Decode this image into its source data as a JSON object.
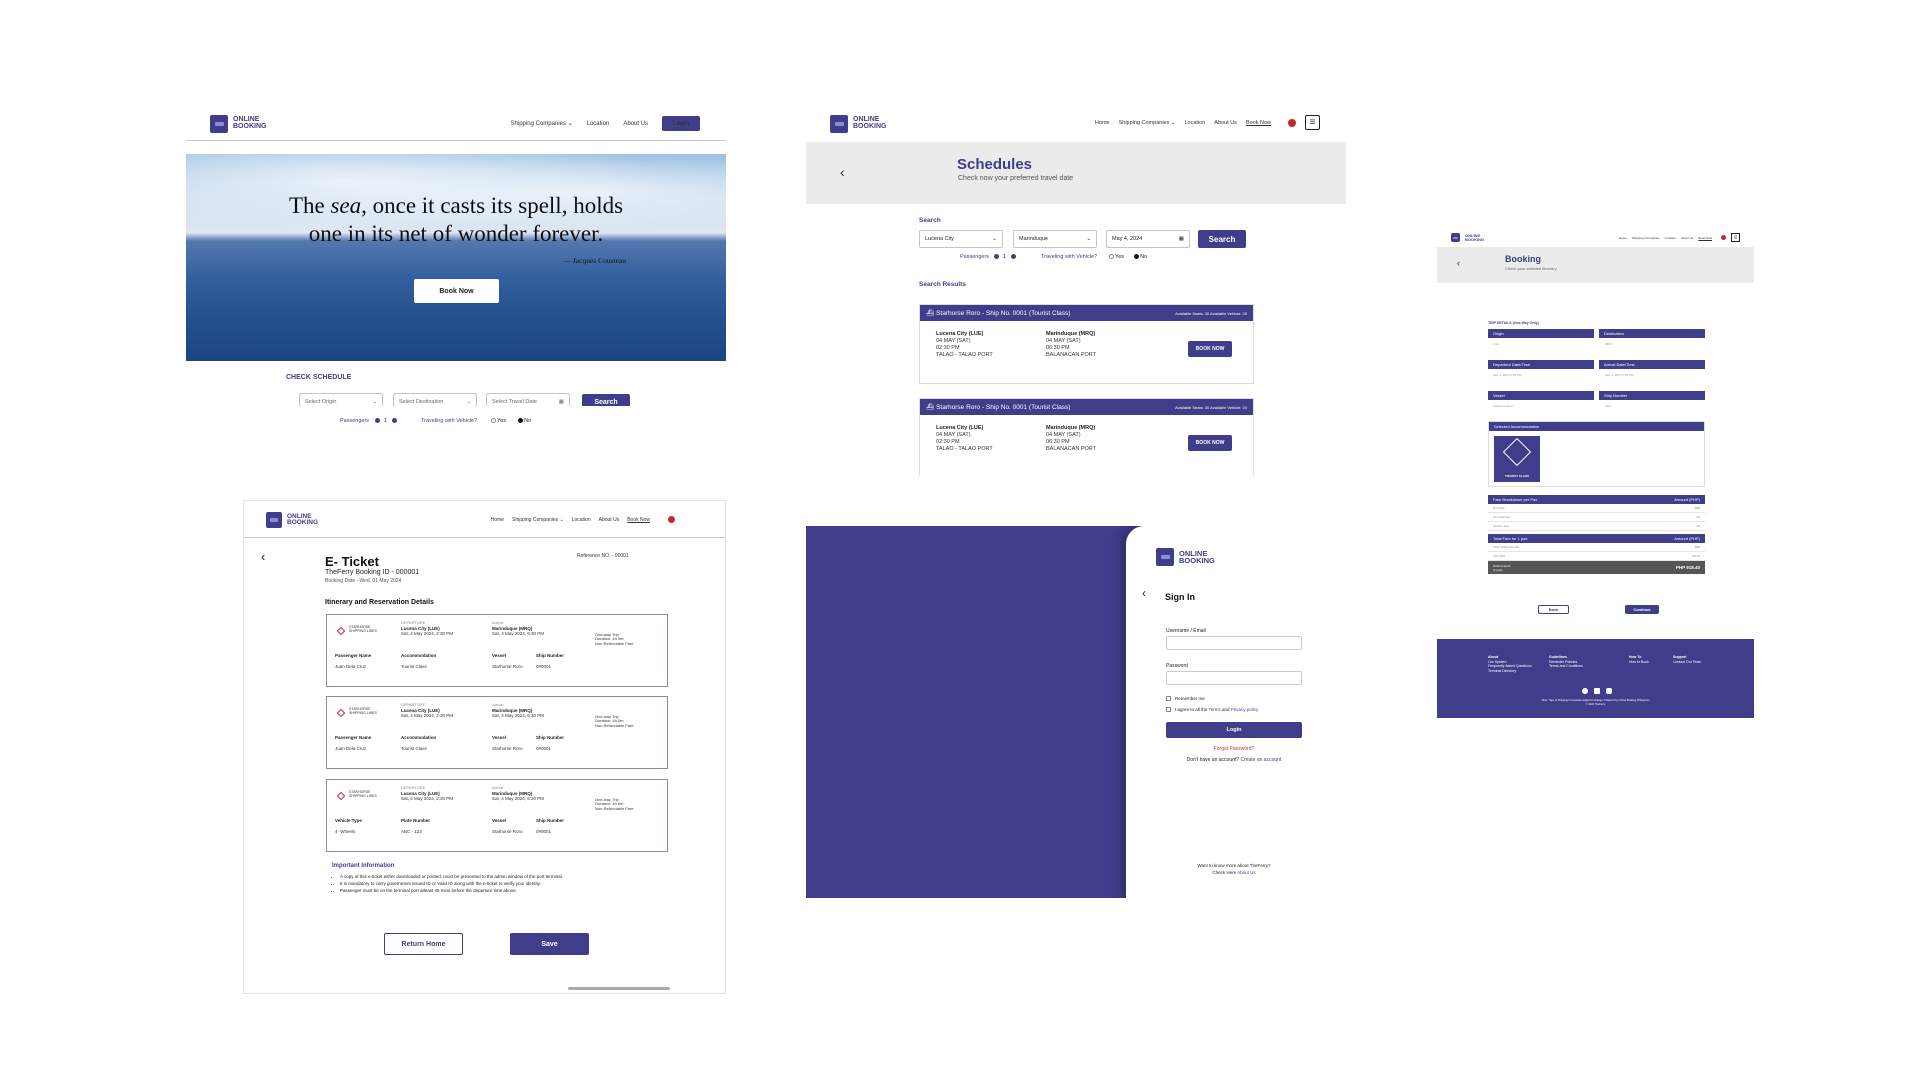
{
  "brand": {
    "line1": "ONLINE",
    "line2": "BOOKING"
  },
  "landing": {
    "nav": {
      "shipping": "Shipping Companies",
      "location": "Location",
      "about": "About Us",
      "login": "Login"
    },
    "quote_line1_a": "The ",
    "quote_sea": "sea",
    "quote_line1_b": ", once it casts its spell, holds",
    "quote_line2": "one in its net of wonder forever.",
    "author": "— Jacques Cousteau",
    "book_now": "Book Now",
    "check_schedule": "CHECK SCHEDULE",
    "origin_placeholder": "Select Origin",
    "destination_placeholder": "Select Destination",
    "date_placeholder": "Select Travel Date",
    "search": "Search",
    "passengers": "Passengers",
    "passenger_count": "1",
    "vehicle_q": "Traveling with Vehicle?",
    "yes": "Yes",
    "no": "No"
  },
  "schedules": {
    "nav": {
      "home": "Home",
      "shipping": "Shipping Companies",
      "location": "Location",
      "about": "About Us",
      "book": "Book Now"
    },
    "title": "Schedules",
    "subtitle": "Check now your preferred travel date",
    "search_label": "Search",
    "origin_value": "Lucena City",
    "destination_value": "Marinduque",
    "date_value": "May 4, 2024",
    "search_btn": "Search",
    "passengers": "Passengers",
    "passenger_count": "1",
    "vehicle_q": "Traveling with Vehicle?",
    "yes": "Yes",
    "no": "No",
    "results_label": "Search Results",
    "results": [
      {
        "header": "Starhorse Roro  -  Ship No. 0001 (Tourist Class)",
        "availability": "Available Seats: 30   Available Vehicle: 20",
        "from_name": "Lucena City (LUE)",
        "from_date": "04 MAY (SAT)",
        "from_time": "02:30 PM",
        "from_port": "TALAO - TALAO PORT",
        "to_name": "Marinduque (MRQ)",
        "to_date": "04 MAY (SAT)",
        "to_time": "06:30 PM",
        "to_port": "BALANACAN PORT",
        "book": "BOOK NOW"
      },
      {
        "header": "Starhorse Roro  -  Ship No. 0001 (Tourist Class)",
        "availability": "Available Seats: 30   Available Vehicle: 20",
        "from_name": "Lucena City (LUE)",
        "from_date": "04 MAY (SAT)",
        "from_time": "02:30 PM",
        "from_port": "TALAO - TALAO PORT",
        "to_name": "Marinduque (MRQ)",
        "to_date": "04 MAY (SAT)",
        "to_time": "06:30 PM",
        "to_port": "BALANACAN PORT",
        "book": "BOOK NOW"
      }
    ]
  },
  "booking": {
    "nav": {
      "home": "Home",
      "shipping": "Shipping Companies",
      "location": "Location",
      "about": "About Us",
      "book": "Book Now"
    },
    "title": "Booking",
    "subtitle": "Check your selected itinerary",
    "trip_details": "TRIP DETAILS (One-Way Only)",
    "origin": "Origin",
    "destination": "Destination",
    "departure": "Departure Date/Time",
    "arrival": "Arrival Date/Time",
    "vessel": "Vessel",
    "ship_number": "Ship Number",
    "origin_val": "LUE",
    "dest_val": "MRQ",
    "dep_val": "May 4, 2024 2:30 PM",
    "arr_val": "May 4, 2024 6:30 PM",
    "vessel_val": "Starhorse Roro",
    "ship_val": "0001",
    "selected_accommodation": "Selected Accommodation",
    "accommodation_card": "TOURIST CLASS",
    "fare_breakdown": "Fare Breakdown per Pax",
    "amount_php": "Amount (PHP)",
    "fare_rows": [
      {
        "label": "Net Fare",
        "value": "800"
      },
      {
        "label": "Terminal Fee",
        "value": "30"
      },
      {
        "label": "Service Fee",
        "value": "50"
      }
    ],
    "total_fare_for": "Total Fare for 1 pax",
    "total_rows": [
      {
        "label": "Total Ticket Amount",
        "value": "880"
      },
      {
        "label": "VAT 12%",
        "value": "98.40"
      }
    ],
    "total_amount_label": "Total Amount",
    "total_amount_sub": "(1 pax)",
    "total_amount_val": "PHP 918.40",
    "back": "Back",
    "continue": "Continue",
    "footer": {
      "cols": [
        {
          "title": "About",
          "items": [
            "Our System",
            "Frequently Asked Questions",
            "Terminal Directory"
          ]
        },
        {
          "title": "Guidelines",
          "items": [
            "Reminder Policies",
            "Terms and Conditions"
          ]
        },
        {
          "title": "How To",
          "items": [
            "How to Book"
          ]
        },
        {
          "title": "Support",
          "items": [
            "Contact Our Team"
          ]
        }
      ],
      "copyright": "Note: Trips of Shipping Companies subject to change. Powered by Online Booking Philippines",
      "copyright2": "© 2024 TheFerry"
    }
  },
  "eticket": {
    "nav": {
      "home": "Home",
      "shipping": "Shipping Companies",
      "location": "Location",
      "about": "About Us",
      "book": "Book Now"
    },
    "title": "E- Ticket",
    "booking_id": "TheFerry Booking ID - 000001",
    "booking_date": "Booking Date - Wed, 01 May 2024",
    "reference": "Reference NO. - 00001",
    "section_title": "Itinerary and Reservation Details",
    "tickets": [
      {
        "company": "STARHORSE SHIPPING LINES",
        "dep_label": "DEPARTURE",
        "dep_city": "Lucena City (LUE)",
        "dep_time": "Sat, 4 May 2024, 2:30 PM",
        "arr_label": "Arrival",
        "arr_city": "Marinduque (MRQ)",
        "arr_time": "Sat, 4 May 2024, 6:30 PM",
        "trip": "One-way Trip",
        "duration": "Duration: 4h 0m",
        "refund": "Non-Refundable Fare",
        "c1_label": "Passenger Name",
        "c1_val": "Juan Dela Cruz",
        "c2_label": "Accommodation",
        "c2_val": "Tourist Class",
        "c3_label": "Vessel",
        "c3_val": "Starhorse Roro",
        "c4_label": "Ship Number",
        "c4_val": "0#0001"
      },
      {
        "company": "STARHORSE SHIPPING LINES",
        "dep_label": "DEPARTURE",
        "dep_city": "Lucena City (LUE)",
        "dep_time": "Sat, 4 May 2024, 2:30 PM",
        "arr_label": "Arrival",
        "arr_city": "Marinduque (MRQ)",
        "arr_time": "Sat, 4 May 2024, 6:30 PM",
        "trip": "One-way Trip",
        "duration": "Duration: 4h 0m",
        "refund": "Non-Refundable Fare",
        "c1_label": "Passenger Name",
        "c1_val": "Juan Dela Cruz",
        "c2_label": "Accommodation",
        "c2_val": "Tourist Class",
        "c3_label": "Vessel",
        "c3_val": "Starhorse Roro",
        "c4_label": "Ship Number",
        "c4_val": "0#0001"
      },
      {
        "company": "STARHORSE SHIPPING LINES",
        "dep_label": "DEPARTURE",
        "dep_city": "Lucena City (LUE)",
        "dep_time": "Sat, 4 May 2024, 2:30 PM",
        "arr_label": "Arrival",
        "arr_city": "Marinduque (MRQ)",
        "arr_time": "Sat, 4 May 2024, 6:30 PM",
        "trip": "One-way Trip",
        "duration": "Duration: 4h 0m",
        "refund": "Non-Refundable Fare",
        "c1_label": "Vehicle Type",
        "c1_val": "4- Wheels",
        "c2_label": "Plate Number",
        "c2_val": "ABC - 123",
        "c3_label": "Vessel",
        "c3_val": "Starhorse Roro",
        "c4_label": "Ship Number",
        "c4_val": "0#0001"
      }
    ],
    "info_title": "Important Information",
    "info": [
      "A copy of this e-ticket either downloaded or printed, must be presented to the admin window of the port terminal.",
      "It is mandatory to carry government issued ID or Valid ID along with the e-ticket to verify your identity.",
      "Passenger must be on the terminal port atleast 45 mins before the departure time above."
    ],
    "return_home": "Return Home",
    "save": "Save"
  },
  "signin": {
    "title": "Sign In",
    "username_label": "Username / Email",
    "password_label": "Password",
    "remember": "Remember me",
    "agree_a": "I agree to all the ",
    "terms": "Terms",
    "agree_b": " and ",
    "privacy": "Privacy policy",
    "login": "Login",
    "forgot": "Forgot Password?",
    "no_account": "Don't have an account? ",
    "create": "Create an account",
    "know_more": "Want to know more about TheFerry?",
    "check_here": "Check Here ",
    "about": "About Us"
  },
  "colors": {
    "primary": "#403d8a",
    "accent_red": "#d32f2f"
  }
}
